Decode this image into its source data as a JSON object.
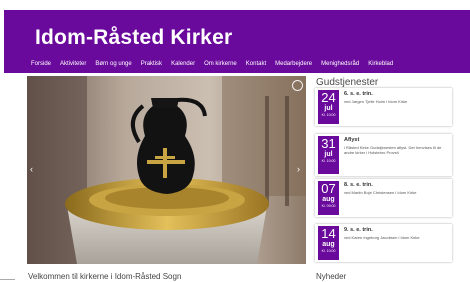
{
  "site": {
    "title": "Idom-Råsted Kirker"
  },
  "nav": [
    {
      "label": "Forside"
    },
    {
      "label": "Aktiviteter"
    },
    {
      "label": "Børn og unge"
    },
    {
      "label": "Praktisk"
    },
    {
      "label": "Kalender"
    },
    {
      "label": "Om kirkerne"
    },
    {
      "label": "Kontakt"
    },
    {
      "label": "Medarbejdere"
    },
    {
      "label": "Menighedsråd"
    },
    {
      "label": "Kirkeblad"
    }
  ],
  "services": {
    "heading": "Gudstjenester",
    "items": [
      {
        "day": "24",
        "month": "jul",
        "time": "Kl. 10:00",
        "title": "6. s. e. trin.",
        "desc": "ved Jørgen Tjelle Holm i Idom Kirke"
      },
      {
        "day": "31",
        "month": "jul",
        "time": "Kl. 10:00",
        "title": "Aflyst",
        "desc": "i Råsted Kirke Gudstjenesten aflyst. Der henvises til de andre kirker i Holstebro Provsti"
      },
      {
        "day": "07",
        "month": "aug",
        "time": "Kl. 09:00",
        "title": "8. s. e. trin.",
        "desc": "ved Martin Boje Christensen i Idom Kirke"
      },
      {
        "day": "14",
        "month": "aug",
        "time": "Kl. 10:00",
        "title": "9. s. e. trin.",
        "desc": "ved Karen Ingeborg Jacobsen i Idom Kirke"
      }
    ]
  },
  "main": {
    "welcome": "Velkommen til kirkerne i Idom-Råsted Sogn"
  },
  "sidebar": {
    "news_heading": "Nyheder"
  },
  "colors": {
    "brand": "#6a0a9c"
  }
}
